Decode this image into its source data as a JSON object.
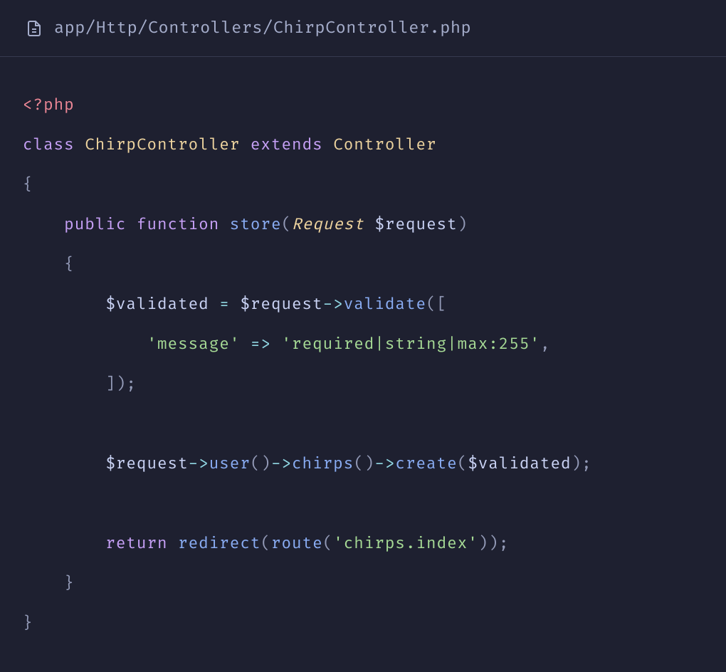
{
  "header": {
    "file_path": "app/Http/Controllers/ChirpController.php"
  },
  "code": {
    "line1_tag": "<?php",
    "line2_class": "class",
    "line2_classname": "ChirpController",
    "line2_extends": "extends",
    "line2_parent": "Controller",
    "line3_brace": "{",
    "line4_public": "public",
    "line4_function": "function",
    "line4_funcname": "store",
    "line4_paren_open": "(",
    "line4_type": "Request",
    "line4_param": "$request",
    "line4_paren_close": ")",
    "line5_brace": "{",
    "line6_var": "$validated",
    "line6_equals": " = ",
    "line6_req": "$request",
    "line6_arrow": "->",
    "line6_method": "validate",
    "line6_call": "([",
    "line7_key": "'message'",
    "line7_fatarrow": "=>",
    "line7_val": "'required|string|max:255'",
    "line7_comma": ",",
    "line8_close": "]);",
    "line9_req": "$request",
    "line9_arrow1": "->",
    "line9_user": "user",
    "line9_call1": "()",
    "line9_arrow2": "->",
    "line9_chirps": "chirps",
    "line9_call2": "()",
    "line9_arrow3": "->",
    "line9_create": "create",
    "line9_open": "(",
    "line9_arg": "$validated",
    "line9_close": ");",
    "line10_return": "return",
    "line10_redirect": "redirect",
    "line10_open1": "(",
    "line10_route": "route",
    "line10_open2": "(",
    "line10_routename": "'chirps.index'",
    "line10_close": "));",
    "line11_brace": "}",
    "line12_brace": "}"
  }
}
